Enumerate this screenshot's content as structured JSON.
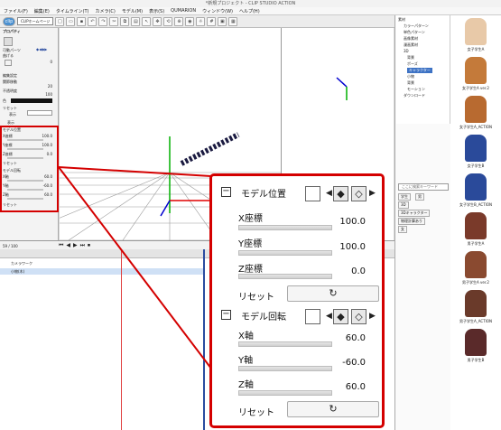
{
  "window": {
    "title": "*新規プロジェクト - CLIP STUDIO ACTION"
  },
  "menu": [
    "ファイル(F)",
    "編集(E)",
    "タイムライン(T)",
    "カメラ(C)",
    "モデル(M)",
    "表示(S)",
    "QUMARION",
    "ウィンドウ(W)",
    "ヘルプ(H)"
  ],
  "toolbar": {
    "badge": "clip",
    "home_label": "CLIPホームページ"
  },
  "left_panel": {
    "title": "プロパティ",
    "parts": "可動パーツ",
    "pose": "曲げる",
    "pose_value": "0",
    "setting": "編集設定",
    "joint": "関節移動",
    "v1": "20",
    "opacity": "不透明度",
    "v2": "100",
    "color": "色",
    "reset1": "リセット",
    "display": "表示",
    "show": "表示",
    "model_pos": "モデル位置",
    "x": "X座標",
    "xv": "100.0",
    "y": "Y座標",
    "yv": "100.0",
    "z": "Z座標",
    "zv": "0.0",
    "reset2": "リセット",
    "model_rot": "モデル回転",
    "xr": "X軸",
    "xrv": "60.0",
    "yr": "Y軸",
    "yrv": "-60.0",
    "zr": "Z軸",
    "zrv": "60.0",
    "reset3": "リセット"
  },
  "tree": {
    "root": "素材",
    "items": [
      "カラーパターン",
      "単色パターン",
      "画像素材",
      "漫画素材",
      "3D",
      "背景",
      "ポーズ",
      "キャラクター",
      "小物",
      "背景",
      "モーション",
      "ダウンロード"
    ]
  },
  "search": {
    "placeholder": "ここに検索キーワード"
  },
  "tags": [
    "学生",
    "男",
    "3D",
    "3Dキャラクター",
    "物理計算あり",
    "女"
  ],
  "thumbs": [
    "女子学生A",
    "女子学生A ver.2",
    "女子学生A_ACTION",
    "女子学生B",
    "女子学生B_ACTION",
    "男子学生A",
    "男子学生A ver.2",
    "男子学生A_ACTION",
    "男子学生B"
  ],
  "timeline": {
    "frame": "59 / 100",
    "track": "カメラワーク",
    "track2": "小物(木)"
  },
  "popup": {
    "model_pos": "モデル位置",
    "x_label": "X座標",
    "x_value": "100.0",
    "y_label": "Y座標",
    "y_value": "100.0",
    "z_label": "Z座標",
    "z_value": "0.0",
    "reset_label": "リセット",
    "model_rot": "モデル回転",
    "xr_label": "X軸",
    "xr_value": "60.0",
    "yr_label": "Y軸",
    "yr_value": "-60.0",
    "zr_label": "Z軸",
    "zr_value": "60.0",
    "reset2_label": "リセット"
  },
  "colors": {
    "highlight": "#d40000",
    "accent": "#2a4ca0"
  }
}
